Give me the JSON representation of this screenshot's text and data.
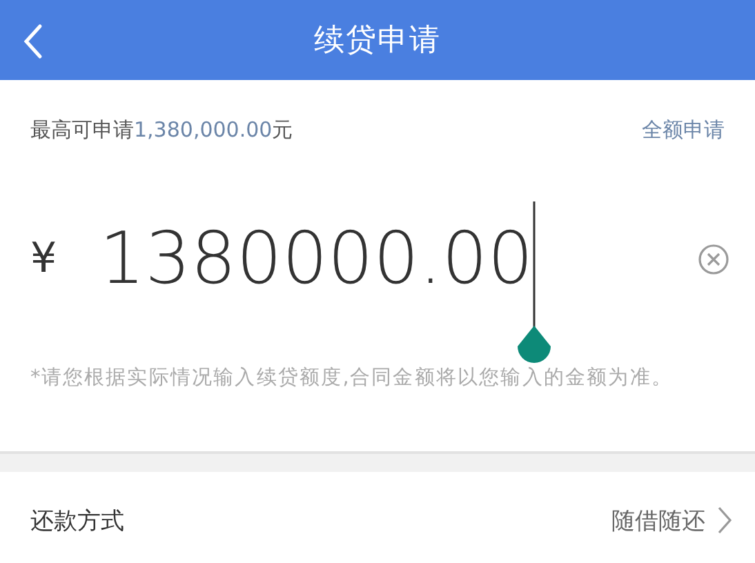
{
  "header": {
    "title": "续贷申请"
  },
  "limit": {
    "label": "最高可申请",
    "amount": "1,380,000.00",
    "unit": "元",
    "action": "全额申请"
  },
  "amount_field": {
    "currency": "¥",
    "value": "1380000.00"
  },
  "note": "*请您根据实际情况输入续贷额度,合同金额将以您输入的金额为准。",
  "repayment": {
    "label": "还款方式",
    "value": "随借随还"
  }
}
